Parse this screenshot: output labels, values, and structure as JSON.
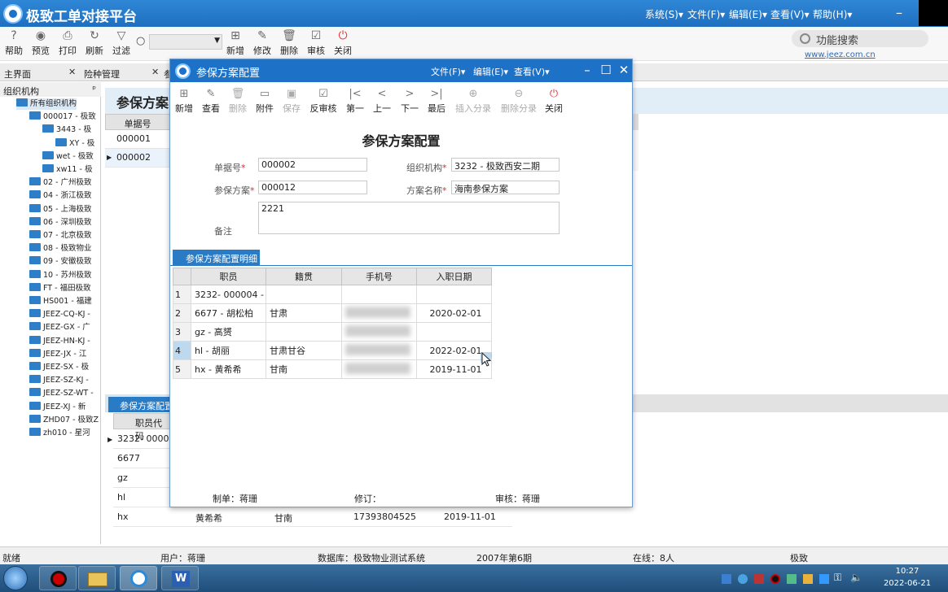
{
  "app": {
    "title": "极致工单对接平台",
    "menus": [
      "系统(S)▾",
      "文件(F)▾",
      "编辑(E)▾",
      "查看(V)▾",
      "帮助(H)▾"
    ]
  },
  "toolbar": {
    "items": [
      {
        "icon": "help-icon",
        "label": "帮助"
      },
      {
        "icon": "eye-icon",
        "label": "预览"
      },
      {
        "icon": "printer-icon",
        "label": "打印"
      },
      {
        "icon": "refresh-icon",
        "label": "刷新"
      },
      {
        "icon": "filter-icon",
        "label": "过滤"
      },
      {
        "icon": "add-icon",
        "label": "新增"
      },
      {
        "icon": "edit-icon",
        "label": "修改"
      },
      {
        "icon": "trash-icon",
        "label": "删除"
      },
      {
        "icon": "check-icon",
        "label": "审核"
      },
      {
        "icon": "power-icon",
        "label": "关闭"
      }
    ],
    "search_placeholder": "功能搜索",
    "url": "www.jeez.com.cn"
  },
  "tabs": [
    {
      "label": "主界面"
    },
    {
      "label": "险种管理"
    },
    {
      "label": "参"
    }
  ],
  "leftpanel": {
    "title": "组织机构",
    "pin": "ᵖ",
    "tree": [
      "所有组织机构",
      "000017 - 极致",
      "3443 - 极",
      "XY - 极",
      "wet - 极致",
      "xw11 - 极",
      "02 - 广州极致",
      "04 - 浙江极致",
      "05 - 上海极致",
      "06 - 深圳极致",
      "07 - 北京极致",
      "08 - 极致物业",
      "09 - 安徽极致",
      "10 - 苏州极致",
      "FT - 福田极致",
      "HS001 - 福建",
      "JEEZ-CQ-KJ -",
      "JEEZ-GX - 广",
      "JEEZ-HN-KJ -",
      "JEEZ-JX - 江",
      "JEEZ-SX - 极",
      "JEEZ-SZ-KJ -",
      "JEEZ-SZ-WT -",
      "JEEZ-XJ - 新",
      "ZHD07 - 极致Z",
      "zh010 - 星河"
    ]
  },
  "background": {
    "title": "参保方案",
    "grid_header": "单据号",
    "rows": [
      "000001",
      "000002"
    ],
    "detail_tab": "参保方案配置",
    "detail_header": "职员代码",
    "detail_rows": [
      {
        "code": "3232- 00000",
        "name": "",
        "hometown": "",
        "phone": "",
        "date": ""
      },
      {
        "code": "6677",
        "name": "",
        "hometown": "",
        "phone": "",
        "date": ""
      },
      {
        "code": "gz",
        "name": "",
        "hometown": "",
        "phone": "",
        "date": ""
      },
      {
        "code": "hl",
        "name": "",
        "hometown": "",
        "phone": "",
        "date": ""
      },
      {
        "code": "hx",
        "name": "黄希希",
        "hometown": "甘南",
        "phone": "17393804525",
        "date": "2019-11-01"
      }
    ]
  },
  "dialog": {
    "title": "参保方案配置",
    "menus": [
      "文件(F)▾",
      "编辑(E)▾",
      "查看(V)▾"
    ],
    "toolbar": [
      {
        "icon": "add-icon",
        "label": "新增",
        "disabled": false
      },
      {
        "icon": "view-icon",
        "label": "查看",
        "disabled": false
      },
      {
        "icon": "trash-icon",
        "label": "删除",
        "disabled": true
      },
      {
        "icon": "folder-icon",
        "label": "附件",
        "disabled": false
      },
      {
        "icon": "save-icon",
        "label": "保存",
        "disabled": true
      },
      {
        "icon": "uncheck-icon",
        "label": "反审核",
        "disabled": false
      },
      {
        "icon": "first-icon",
        "label": "第一",
        "disabled": false
      },
      {
        "icon": "prev-icon",
        "label": "上一",
        "disabled": false
      },
      {
        "icon": "next-icon",
        "label": "下一",
        "disabled": false
      },
      {
        "icon": "last-icon",
        "label": "最后",
        "disabled": false
      },
      {
        "icon": "insert-icon",
        "label": "插入分录",
        "disabled": true
      },
      {
        "icon": "remove-icon",
        "label": "删除分录",
        "disabled": true
      },
      {
        "icon": "power-icon",
        "label": "关闭",
        "disabled": false
      }
    ],
    "heading": "参保方案配置",
    "fields": {
      "doc_no_label": "单据号",
      "doc_no": "000002",
      "org_label": "组织机构",
      "org": "3232 - 极致西安二期",
      "plan_label": "参保方案",
      "plan": "000012",
      "plan_name_label": "方案名称",
      "plan_name": "海南参保方案",
      "remark_label": "备注",
      "remark": "2221"
    },
    "detail_tab": "参保方案配置明细",
    "columns": [
      "职员",
      "籍贯",
      "手机号",
      "入职日期"
    ],
    "rows": [
      {
        "n": "1",
        "emp": "3232- 000004 -",
        "hometown": "",
        "phone": "",
        "date": ""
      },
      {
        "n": "2",
        "emp": "6677 - 胡松柏",
        "hometown": "甘肃",
        "phone": "",
        "date": "2020-02-01"
      },
      {
        "n": "3",
        "emp": "gz - 高赟",
        "hometown": "",
        "phone": "",
        "date": ""
      },
      {
        "n": "4",
        "emp": "hl - 胡丽",
        "hometown": "甘肃甘谷",
        "phone": "",
        "date": "2022-02-01"
      },
      {
        "n": "5",
        "emp": "hx - 黄希希",
        "hometown": "甘南",
        "phone": "",
        "date": "2019-11-01"
      }
    ],
    "footer": {
      "maker": "制单：蒋珊",
      "revise": "修订：",
      "auditor": "审核：蒋珊"
    }
  },
  "status": {
    "ready": "就绪",
    "user": "用户：蒋珊",
    "db": "数据库：极致物业测试系统",
    "period": "2007年第6期",
    "online": "在线：8人",
    "extra": "极致"
  },
  "clock": {
    "time": "10:27",
    "date": "2022-06-21"
  }
}
